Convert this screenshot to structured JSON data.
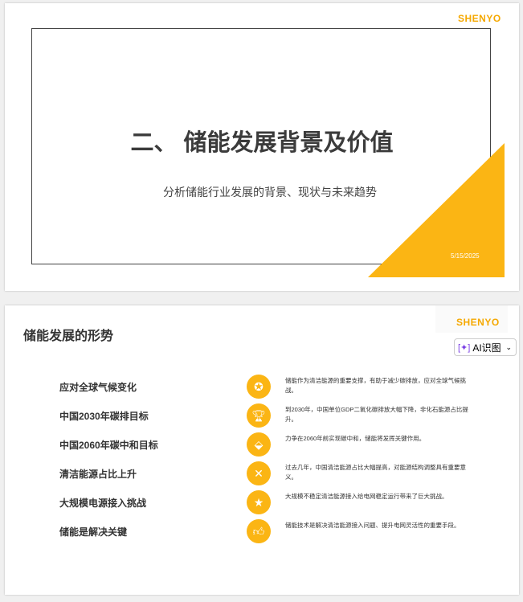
{
  "slide1": {
    "logo": "SHENYO",
    "title": "二、 储能发展背景及价值",
    "subtitle": "分析储能行业发展的背景、现状与未来趋势",
    "date": "5/15/2025",
    "accent": "#fbb514"
  },
  "slide2": {
    "logo": "SHENYO",
    "title": "储能发展的形势",
    "ai_button": "AI识图",
    "rows": [
      {
        "label": "应对全球气候变化",
        "icon": "award-ribbon-icon",
        "desc": "储能作为清洁能源的重要支撑，有助于减少碳排放，应对全球气候挑战。"
      },
      {
        "label": "中国2030年碳排目标",
        "icon": "trophy-icon",
        "desc": "到2030年，中国单位GDP二氧化碳排放大幅下降，非化石能源占比提升。"
      },
      {
        "label": "中国2060年碳中和目标",
        "icon": "tag-icon",
        "desc": "力争在2060年前实现碳中和，储能将发挥关键作用。"
      },
      {
        "label": "清洁能源占比上升",
        "icon": "crossed-flags-icon",
        "desc": "过去几年，中国清洁能源占比大幅提高，对能源结构调整具有重要意义。"
      },
      {
        "label": "大规模电源接入挑战",
        "icon": "medal-icon",
        "desc": "大规模不稳定清洁能源接入给电网稳定运行带来了巨大挑战。"
      },
      {
        "label": "储能是解决关键",
        "icon": "thumbs-up-icon",
        "desc": "储能技术是解决清洁能源接入问题、提升电网灵活性的重要手段。"
      }
    ]
  }
}
